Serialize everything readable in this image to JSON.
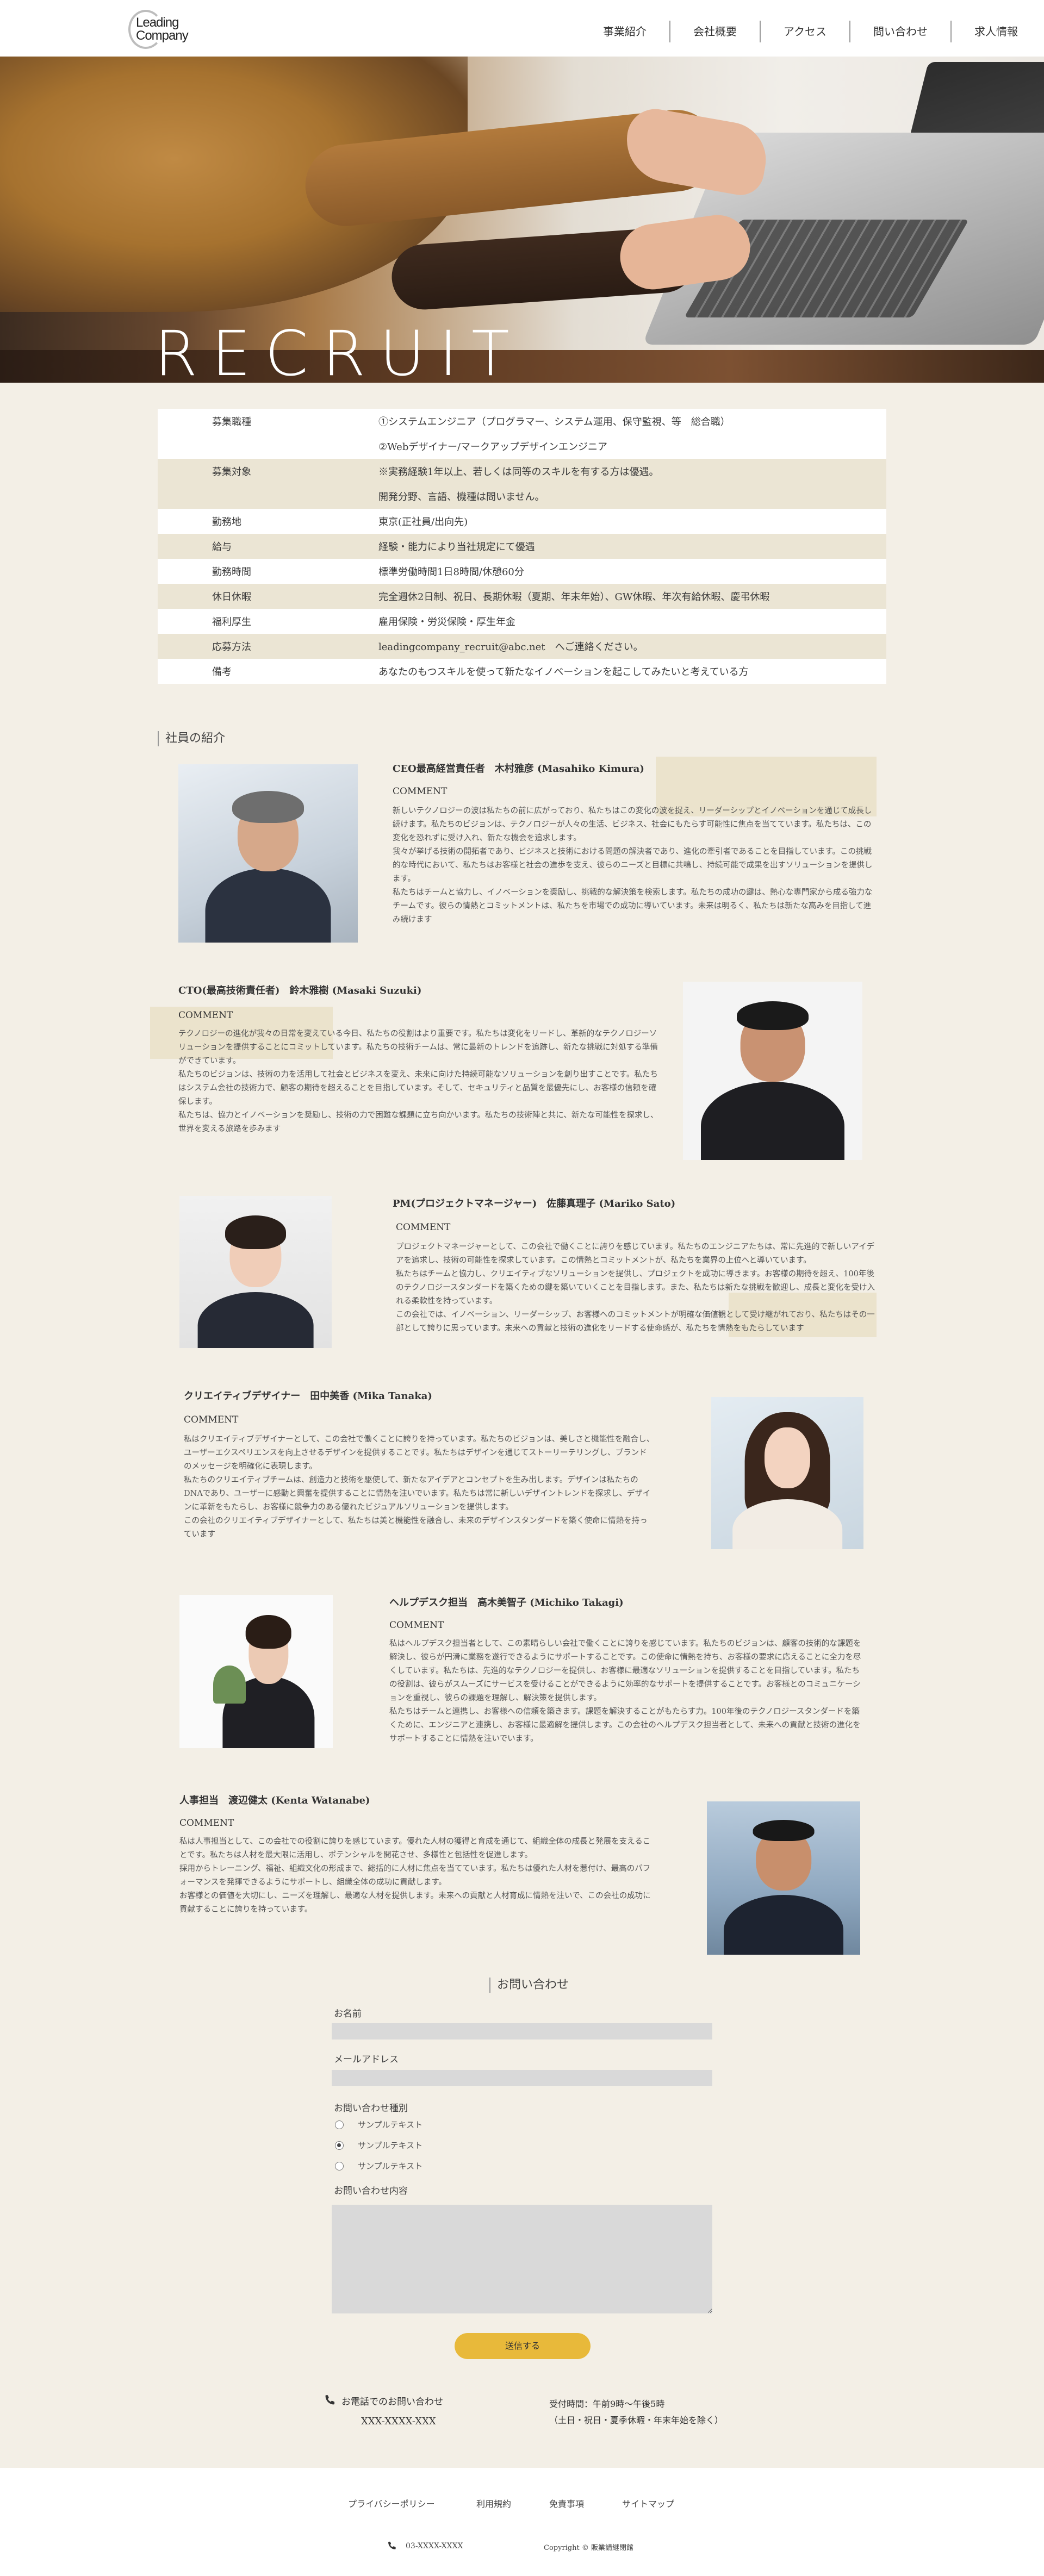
{
  "header": {
    "logo_line1": "Leading",
    "logo_line2": "Company",
    "nav": [
      "事業紹介",
      "会社概要",
      "アクセス",
      "問い合わせ",
      "求人情報"
    ]
  },
  "hero": {
    "title": "RECRUIT"
  },
  "recruit_table": [
    {
      "key": "募集職種",
      "value": "①システムエンジニア（プログラマー、システム運用、保守監視、等　総合職）"
    },
    {
      "key": "",
      "value": "②Webデザイナー/マークアップデザインエンジニア"
    },
    {
      "key": "募集対象",
      "value": "※実務経験1年以上、若しくは同等のスキルを有する方は優遇。"
    },
    {
      "key": "",
      "value": "開発分野、言語、機種は問いません。"
    },
    {
      "key": "勤務地",
      "value": "東京(正社員/出向先)"
    },
    {
      "key": "給与",
      "value": "経験・能力により当社規定にて優遇"
    },
    {
      "key": "勤務時間",
      "value": "標準労働時間1日8時間/休憩60分"
    },
    {
      "key": "休日休暇",
      "value": "完全週休2日制、祝日、長期休暇（夏期、年末年始）、GW休暇、年次有給休暇、慶弔休暇"
    },
    {
      "key": "福利厚生",
      "value": "雇用保険・労災保険・厚生年金"
    },
    {
      "key": "応募方法",
      "value": "leadingcompany_recruit@abc.net　へご連絡ください。"
    },
    {
      "key": "備考",
      "value": "あなたのもつスキルを使って新たなイノベーションを起こしてみたいと考えている方"
    }
  ],
  "staff_section_title": "社員の紹介",
  "staff": [
    {
      "name": "CEO最高経営責任者　木村雅彦 (Masahiko Kimura)",
      "comment_label": "COMMENT",
      "paragraphs": [
        "新しいテクノロジーの波は私たちの前に広がっており、私たちはこの変化の波を捉え、リーダーシップとイノベーションを通じて成長し続けます。私たちのビジョンは、テクノロジーが人々の生活、ビジネス、社会にもたらす可能性に焦点を当てています。私たちは、この変化を恐れずに受け入れ、新たな機会を追求します。",
        "我々が挙げる技術の開拓者であり、ビジネスと技術における問題の解決者であり、進化の牽引者であることを目指しています。この挑戦的な時代において、私たちはお客様と社会の進歩を支え、彼らのニーズと目標に共鳴し、持続可能で成果を出すソリューションを提供します。",
        "私たちはチームと協力し、イノベーションを奨励し、挑戦的な解決策を検索します。私たちの成功の鍵は、熱心な専門家から成る強力なチームです。彼らの情熱とコミットメントは、私たちを市場での成功に導いています。未来は明るく、私たちは新たな高みを目指して進み続けます"
      ]
    },
    {
      "name": "CTO(最高技術責任者)　鈴木雅樹 (Masaki Suzuki)",
      "comment_label": "COMMENT",
      "paragraphs": [
        "テクノロジーの進化が我々の日常を変えている今日、私たちの役割はより重要です。私たちは変化をリードし、革新的なテクノロジーソリューションを提供することにコミットしています。私たちの技術チームは、常に最新のトレンドを追跡し、新たな挑戦に対処する準備ができています。",
        "私たちのビジョンは、技術の力を活用して社会とビジネスを変え、未来に向けた持続可能なソリューションを創り出すことです。私たちはシステム会社の技術力で、顧客の期待を超えることを目指しています。そして、セキュリティと品質を最優先にし、お客様の信頼を確保します。",
        "私たちは、協力とイノベーションを奨励し、技術の力で困難な課題に立ち向かいます。私たちの技術陣と共に、新たな可能性を探求し、世界を変える旅路を歩みます"
      ]
    },
    {
      "name": "PM(プロジェクトマネージャー)　佐藤真理子 (Mariko Sato)",
      "comment_label": "COMMENT",
      "paragraphs": [
        "プロジェクトマネージャーとして、この会社で働くことに誇りを感じています。私たちのエンジニアたちは、常に先進的で新しいアイデアを追求し、技術の可能性を探求しています。この情熱とコミットメントが、私たちを業界の上位へと導いています。",
        "私たちはチームと協力し、クリエイティブなソリューションを提供し、プロジェクトを成功に導きます。お客様の期待を超え、100年後のテクノロジースタンダードを築くための鍵を築いていくことを目指します。また、私たちは新たな挑戦を歓迎し、成長と変化を受け入れる柔軟性を持っています。",
        "この会社では、イノベーション、リーダーシップ、お客様へのコミットメントが明確な価値観として受け継がれており、私たちはその一部として誇りに思っています。未来への貢献と技術の進化をリードする使命感が、私たちを情熱をもたらしています"
      ]
    },
    {
      "name": "クリエイティブデザイナー　田中美香 (Mika Tanaka)",
      "comment_label": "COMMENT",
      "paragraphs": [
        "私はクリエイティブデザイナーとして、この会社で働くことに誇りを持っています。私たちのビジョンは、美しさと機能性を融合し、ユーザーエクスペリエンスを向上させるデザインを提供することです。私たちはデザインを通じてストーリーテリングし、ブランドのメッセージを明確化に表現します。",
        "私たちのクリエイティブチームは、創造力と技術を駆使して、新たなアイデアとコンセプトを生み出します。デザインは私たちのDNAであり、ユーザーに感動と興奮を提供することに情熱を注いでいます。私たちは常に新しいデザイントレンドを探求し、デザインに革新をもたらし、お客様に競争力のある優れたビジュアルソリューションを提供します。",
        "この会社のクリエイティブデザイナーとして、私たちは美と機能性を融合し、未来のデザインスタンダードを築く使命に情熱を持っています"
      ]
    },
    {
      "name": "ヘルプデスク担当　高木美智子 (Michiko Takagi)",
      "comment_label": "COMMENT",
      "paragraphs": [
        "私はヘルプデスク担当者として、この素晴らしい会社で働くことに誇りを感じています。私たちのビジョンは、顧客の技術的な課題を解決し、彼らが円滑に業務を遂行できるようにサポートすることです。この使命に情熱を持ち、お客様の要求に応えることに全力を尽くしています。私たちは、先進的なテクノロジーを提供し、お客様に最適なソリューションを提供することを目指しています。私たちの役割は、彼らがスムーズにサービスを受けることができるように効率的なサポートを提供することです。お客様とのコミュニケーションを重視し、彼らの課題を理解し、解決策を提供します。",
        "私たちはチームと連携し、お客様への信頼を築きます。課題を解決することがもたらす力。100年後のテクノロジースタンダードを築くために、エンジニアと連携し、お客様に最適解を提供します。この会社のヘルプデスク担当者として、未来への貢献と技術の進化をサポートすることに情熱を注いでいます。"
      ]
    },
    {
      "name": "人事担当　渡辺健太 (Kenta Watanabe)",
      "comment_label": "COMMENT",
      "paragraphs": [
        "私は人事担当として、この会社での役割に誇りを感じています。優れた人材の獲得と育成を通じて、組織全体の成長と発展を支えることです。私たちは人材を最大限に活用し、ポテンシャルを開花させ、多様性と包括性を促進します。",
        "採用からトレーニング、福祉、組織文化の形成まで、総括的に人材に焦点を当てています。私たちは優れた人材を惹付け、最高のパフォーマンスを発揮できるようにサポートし、組織全体の成功に貢献します。",
        "お客様との価値を大切にし、ニーズを理解し、最適な人材を提供します。未来への貢献と人材育成に情熱を注いで、この会社の成功に貢献することに誇りを持っています。"
      ]
    }
  ],
  "contact": {
    "title": "お問い合わせ",
    "name_label": "お名前",
    "email_label": "メールアドレス",
    "type_label": "お問い合わせ種別",
    "options": [
      "サンプルテキスト",
      "サンプルテキスト",
      "サンプルテキスト"
    ],
    "selected_index": 1,
    "content_label": "お問い合わせ内容",
    "submit_label": "送信する",
    "phone_title": "お電話でのお問い合わせ",
    "phone_number": "XXX-XXXX-XXX",
    "hours_line1": "受付時間：午前9時〜午後5時",
    "hours_line2": "（土日・祝日・夏季休暇・年末年始を除く）"
  },
  "footer": {
    "links": [
      "プライバシーポリシー",
      "利用規約",
      "免責事項",
      "サイトマップ"
    ],
    "phone": "03-XXXX-XXXX",
    "copyright": "Copyright © 販業請継閉館"
  },
  "colors": {
    "background": "#f3efe6",
    "table_band": "#ebe5d4",
    "highlight": "#ebe3cc",
    "submit_button": "#e8b93a",
    "input_fill": "#d9d9d9"
  }
}
